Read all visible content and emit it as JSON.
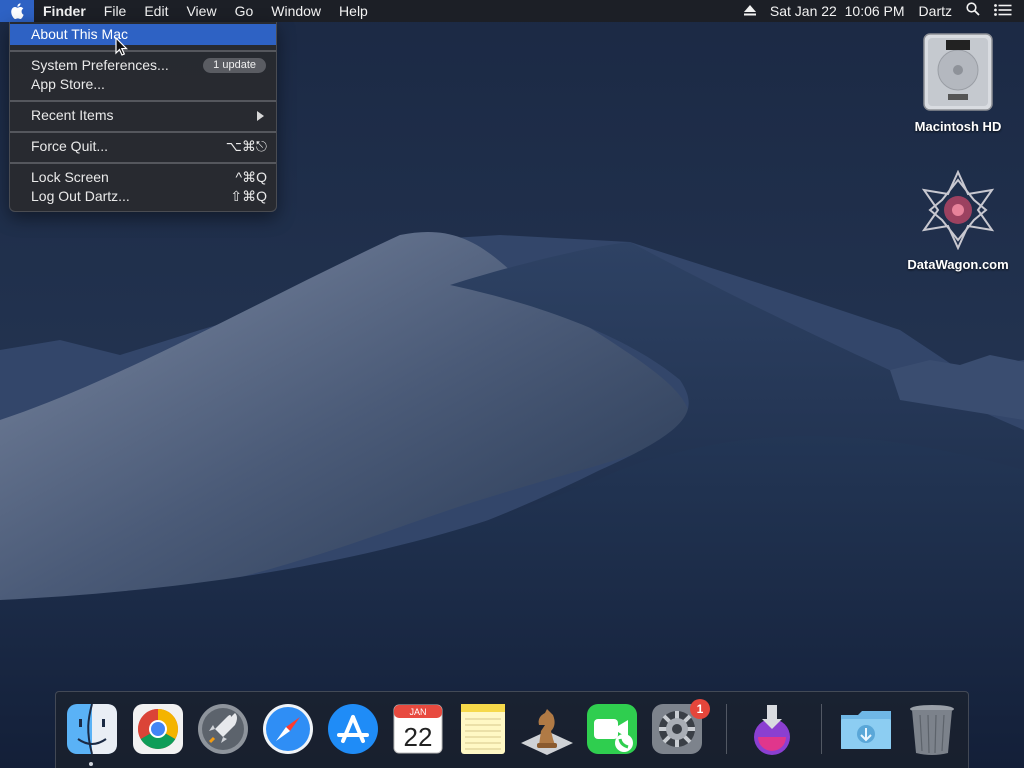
{
  "menubar": {
    "apple_icon": "apple-logo-icon",
    "app_name": "Finder",
    "menus": [
      "File",
      "Edit",
      "View",
      "Go",
      "Window",
      "Help"
    ],
    "eject_icon": "eject-icon",
    "clock": "Sat Jan 22  10:06 PM",
    "user": "Dartz",
    "search_icon": "spotlight-search-icon",
    "notification_icon": "notification-center-icon"
  },
  "apple_menu": {
    "about": "About This Mac",
    "system_prefs": "System Preferences...",
    "system_prefs_badge": "1 update",
    "app_store": "App Store...",
    "recent_items": "Recent Items",
    "force_quit": "Force Quit...",
    "force_quit_shortcut": "⌥⌘⎋",
    "lock_screen": "Lock Screen",
    "lock_screen_shortcut": "^⌘Q",
    "log_out": "Log Out Dartz...",
    "log_out_shortcut": "⇧⌘Q"
  },
  "desktop": {
    "icons": [
      {
        "label": "Macintosh HD",
        "icon": "hard-drive-icon"
      },
      {
        "label": "DataWagon.com",
        "icon": "datawagon-logo-icon"
      }
    ]
  },
  "dock": {
    "items": [
      {
        "name": "Finder",
        "icon": "finder-icon"
      },
      {
        "name": "Google Chrome",
        "icon": "chrome-icon"
      },
      {
        "name": "Launchpad",
        "icon": "launchpad-rocket-icon"
      },
      {
        "name": "Safari",
        "icon": "safari-compass-icon"
      },
      {
        "name": "App Store",
        "icon": "app-store-icon"
      },
      {
        "name": "Calendar",
        "icon": "calendar-icon",
        "month": "JAN",
        "day": "22"
      },
      {
        "name": "Notes",
        "icon": "notes-icon"
      },
      {
        "name": "Chess",
        "icon": "chess-knight-icon"
      },
      {
        "name": "FaceTime",
        "icon": "facetime-icon"
      },
      {
        "name": "System Preferences",
        "icon": "system-preferences-gear-icon",
        "badge": "1"
      },
      {
        "name": "Installer",
        "icon": "installer-icon"
      },
      {
        "name": "Downloads",
        "icon": "downloads-folder-icon"
      },
      {
        "name": "Trash",
        "icon": "trash-icon"
      }
    ]
  },
  "colors": {
    "menu_highlight": "#2e62c4",
    "badge_red": "#e5463b"
  }
}
